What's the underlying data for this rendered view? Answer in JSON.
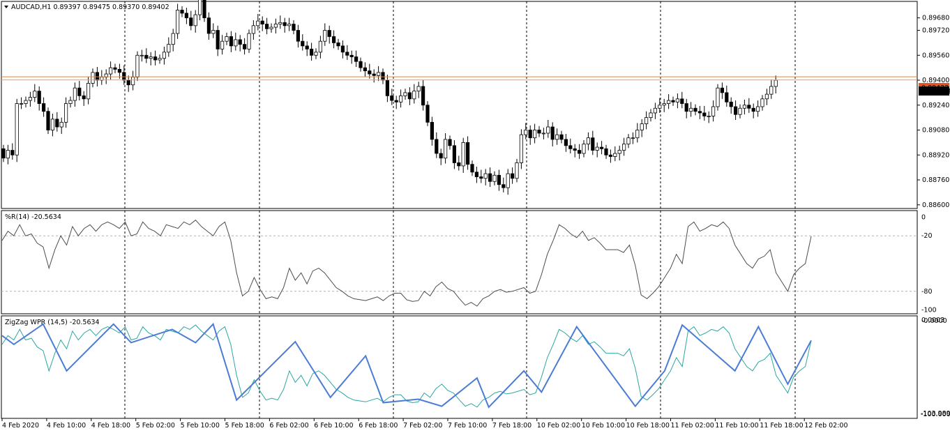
{
  "colors": {
    "background": "#ffffff",
    "grid": "#000000",
    "candle_up_fill": "#ffffff",
    "candle_down_fill": "#000000",
    "candle_outline": "#000000",
    "price_line": "#d9884a",
    "price_label_bg": "#000000",
    "price_label_text": "#ffffff",
    "ask_label_bg": "#e8531c",
    "wpr_line": "#4d4d4d",
    "wpr_level": "#b0b0b0",
    "zz_wpr_line": "#2aa7a0",
    "zigzag_line": "#4a7cd6"
  },
  "main_panel": {
    "header": "AUDCAD,H1  0.89397 0.89475 0.89370 0.89402",
    "header_icon": "triangle-down-icon",
    "current_price": "0.89402",
    "ask_price": "0.89422"
  },
  "wpr_panel": {
    "header": "%R(14) -20.5634"
  },
  "zigzag_panel": {
    "header": "ZigZag WPR (14,5) -20.5634",
    "axis_labels": [
      "0.0003",
      "-0.0000",
      "-103.9895",
      "-100.0000"
    ]
  },
  "time_labels": [
    "4 Feb 2020",
    "4 Feb 10:00",
    "4 Feb 18:00",
    "5 Feb 02:00",
    "5 Feb 10:00",
    "5 Feb 18:00",
    "6 Feb 02:00",
    "6 Feb 10:00",
    "6 Feb 18:00",
    "7 Feb 02:00",
    "7 Feb 10:00",
    "7 Feb 18:00",
    "10 Feb 02:00",
    "10 Feb 10:00",
    "10 Feb 18:00",
    "11 Feb 02:00",
    "11 Feb 10:00",
    "11 Feb 18:00",
    "12 Feb 02:00"
  ],
  "chart_data": [
    {
      "type": "candlestick",
      "symbol": "AUDCAD",
      "timeframe": "H1",
      "title": "AUDCAD,H1  0.89397 0.89475 0.89370 0.89402",
      "y_ticks": [
        "0.89680",
        "0.89720",
        "0.89560",
        "0.89400",
        "0.89240",
        "0.89080",
        "0.88920",
        "0.88760",
        "0.88600"
      ],
      "ylim": [
        0.8859,
        0.8987
      ],
      "current_price": 0.89402,
      "x_labels": [
        "4 Feb 2020",
        "4 Feb 10:00",
        "4 Feb 18:00",
        "5 Feb 02:00",
        "5 Feb 10:00",
        "5 Feb 18:00",
        "6 Feb 02:00",
        "6 Feb 10:00",
        "6 Feb 18:00",
        "7 Feb 02:00",
        "7 Feb 10:00",
        "7 Feb 18:00",
        "10 Feb 02:00",
        "10 Feb 10:00",
        "10 Feb 18:00",
        "11 Feb 02:00",
        "11 Feb 10:00",
        "11 Feb 18:00",
        "12 Feb 02:00"
      ],
      "close": [
        0.889,
        0.8895,
        0.8892,
        0.8925,
        0.8925,
        0.8927,
        0.8929,
        0.8933,
        0.8925,
        0.892,
        0.8908,
        0.8915,
        0.891,
        0.8913,
        0.8925,
        0.8927,
        0.8935,
        0.893,
        0.8928,
        0.8938,
        0.8945,
        0.894,
        0.8942,
        0.8944,
        0.8948,
        0.8947,
        0.8945,
        0.894,
        0.8937,
        0.8942,
        0.8956,
        0.8956,
        0.8954,
        0.8955,
        0.8953,
        0.8954,
        0.8958,
        0.8963,
        0.897,
        0.8985,
        0.8983,
        0.898,
        0.8975,
        0.8982,
        0.8992,
        0.898,
        0.897,
        0.8972,
        0.896,
        0.8965,
        0.8968,
        0.8962,
        0.8966,
        0.8963,
        0.896,
        0.897,
        0.8975,
        0.8978,
        0.8976,
        0.8973,
        0.8974,
        0.8976,
        0.8977,
        0.8975,
        0.8976,
        0.8972,
        0.8965,
        0.8962,
        0.896,
        0.8956,
        0.8958,
        0.8965,
        0.8972,
        0.8968,
        0.8964,
        0.8962,
        0.8958,
        0.8956,
        0.8955,
        0.8952,
        0.8948,
        0.8946,
        0.8944,
        0.8943,
        0.8945,
        0.894,
        0.893,
        0.8927,
        0.8926,
        0.893,
        0.8932,
        0.8928,
        0.8933,
        0.8936,
        0.8924,
        0.8913,
        0.8902,
        0.8893,
        0.889,
        0.8902,
        0.8898,
        0.8887,
        0.8885,
        0.89,
        0.8886,
        0.8881,
        0.8878,
        0.8877,
        0.888,
        0.8875,
        0.8879,
        0.8873,
        0.8871,
        0.888,
        0.8877,
        0.8887,
        0.8905,
        0.8908,
        0.8903,
        0.8908,
        0.8906,
        0.8906,
        0.891,
        0.8902,
        0.8905,
        0.8902,
        0.8898,
        0.8896,
        0.8895,
        0.8893,
        0.8899,
        0.8903,
        0.8895,
        0.8897,
        0.8896,
        0.8892,
        0.8891,
        0.8893,
        0.8895,
        0.8899,
        0.8903,
        0.8903,
        0.8908,
        0.8912,
        0.8916,
        0.8919,
        0.8922,
        0.8924,
        0.8925,
        0.8927,
        0.8926,
        0.8928,
        0.8925,
        0.892,
        0.8922,
        0.892,
        0.8919,
        0.8917,
        0.8917,
        0.8923,
        0.8935,
        0.8932,
        0.8926,
        0.8923,
        0.8918,
        0.8922,
        0.8924,
        0.8922,
        0.892,
        0.8923,
        0.8928,
        0.8931,
        0.8936,
        0.894
      ]
    },
    {
      "type": "line",
      "name": "%R(14)",
      "title": "%R(14) -20.5634",
      "y_ticks": [
        "0",
        "-20",
        "-80",
        "-100"
      ],
      "levels": [
        -20,
        -80
      ],
      "ylim": [
        -102,
        2
      ],
      "values": [
        -25,
        -15,
        -20,
        -8,
        -20,
        -18,
        -28,
        -32,
        -55,
        -35,
        -20,
        -30,
        -10,
        -20,
        -12,
        -8,
        -15,
        -8,
        -5,
        -8,
        -12,
        -5,
        -20,
        -18,
        -5,
        -12,
        -15,
        -20,
        -8,
        -10,
        -12,
        -5,
        -8,
        -3,
        -10,
        -15,
        -20,
        -10,
        -5,
        -25,
        -60,
        -85,
        -80,
        -65,
        -78,
        -88,
        -86,
        -88,
        -76,
        -55,
        -68,
        -60,
        -72,
        -58,
        -55,
        -60,
        -68,
        -76,
        -80,
        -85,
        -88,
        -89,
        -90,
        -88,
        -86,
        -90,
        -85,
        -82,
        -82,
        -89,
        -91,
        -90,
        -80,
        -85,
        -75,
        -70,
        -77,
        -80,
        -88,
        -95,
        -92,
        -96,
        -88,
        -85,
        -80,
        -78,
        -81,
        -80,
        -78,
        -76,
        -82,
        -80,
        -62,
        -40,
        -25,
        -8,
        -12,
        -18,
        -22,
        -15,
        -25,
        -22,
        -28,
        -35,
        -35,
        -35,
        -38,
        -30,
        -52,
        -84,
        -88,
        -82,
        -75,
        -65,
        -55,
        -40,
        -50,
        -10,
        -5,
        -15,
        -12,
        -8,
        -10,
        -5,
        -12,
        -30,
        -40,
        -50,
        -55,
        -45,
        -42,
        -35,
        -60,
        -70,
        -80,
        -62,
        -55,
        -50,
        -20.5634
      ]
    },
    {
      "type": "line",
      "name": "ZigZag WPR (14,5)",
      "title": "ZigZag WPR (14,5) -20.5634",
      "ylim": [
        -104,
        1
      ],
      "zigzag_pivots": [
        -15,
        -25,
        -2,
        -55,
        -2,
        -23,
        -8,
        -23,
        -2,
        -88,
        -22,
        -85,
        -38,
        -91,
        -87,
        -95,
        -63,
        -96,
        -55,
        -79,
        -5,
        -95,
        -55,
        -3,
        -55,
        -5,
        -70,
        -20.5634
      ]
    }
  ]
}
